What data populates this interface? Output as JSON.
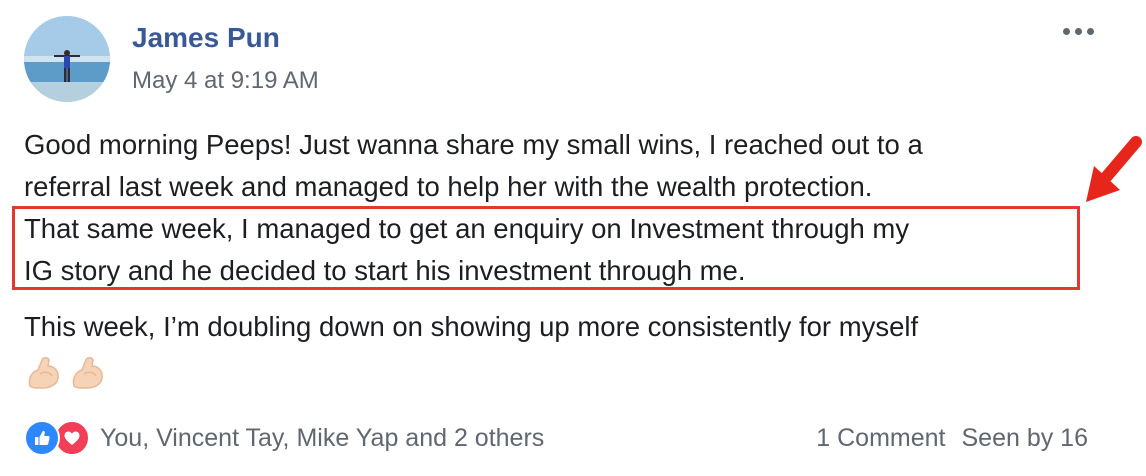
{
  "post": {
    "author": "James Pun",
    "timestamp": "May 4 at 9:19 AM",
    "body_lines": [
      "Good morning Peeps! Just wanna share my small wins, I reached out to a",
      "referral last week and managed to help her with the wealth protection.",
      "That same week, I managed to get an enquiry on Investment through my",
      "IG story and he decided to start his investment through me.",
      "This week, I’m doubling down on showing up more consistently for myself"
    ],
    "emojis": [
      "flexed-biceps-emoji",
      "flexed-biceps-emoji"
    ]
  },
  "reactions": {
    "icons": [
      "like-icon",
      "love-icon"
    ],
    "reactors_text": "You, Vincent Tay, Mike Yap and 2 others"
  },
  "stats": {
    "comments": "1 Comment",
    "seen_by": "Seen by 16"
  },
  "annotation": {
    "highlight_color": "#e03a2f",
    "arrow_color": "#e6261a"
  },
  "colors": {
    "author_link": "#385898",
    "meta_text": "#606770",
    "like_blue": "#2d88ff",
    "love_red": "#f33e58"
  }
}
